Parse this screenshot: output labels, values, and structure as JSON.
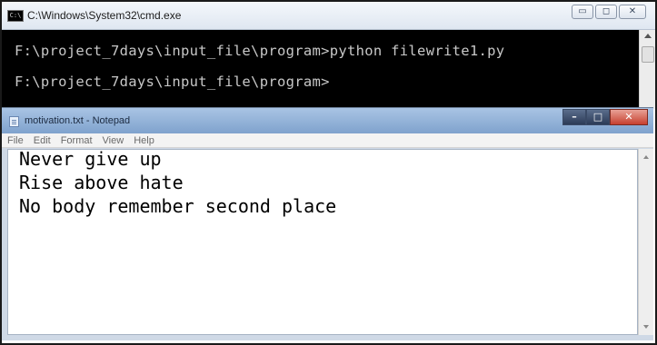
{
  "cmd": {
    "icon_label": "C:\\",
    "title": "C:\\Windows\\System32\\cmd.exe",
    "lines": [
      "F:\\project_7days\\input_file\\program>python filewrite1.py",
      "F:\\project_7days\\input_file\\program>"
    ],
    "buttons": {
      "minimize": "▭",
      "maximize": "◻",
      "close": "✕"
    }
  },
  "notepad": {
    "title": "motivation.txt - Notepad",
    "buttons": {
      "minimize": "–",
      "maximize": "□",
      "close": "✕"
    },
    "menu": [
      "File",
      "Edit",
      "Format",
      "View",
      "Help"
    ],
    "content_lines": [
      "Never give up",
      "Rise above hate",
      "No body remember second place"
    ]
  },
  "colors": {
    "console_bg": "#000000",
    "console_text": "#c8c8c8",
    "notepad_titlebar": "#8fb0d8",
    "close_button": "#c7402f"
  }
}
